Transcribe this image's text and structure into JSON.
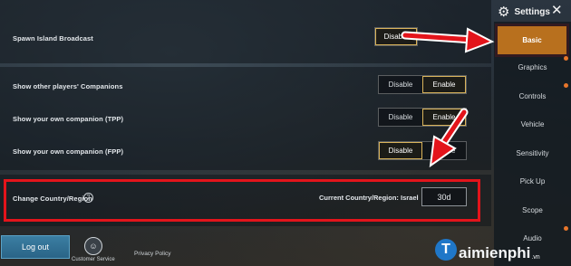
{
  "settings": {
    "spawn_island": {
      "label": "Spawn Island Broadcast",
      "option": "Disable"
    },
    "companions": [
      {
        "label": "Show other players' Companions",
        "disable": "Disable",
        "enable": "Enable",
        "selected": "Enable"
      },
      {
        "label": "Show your own companion (TPP)",
        "disable": "Disable",
        "enable": "Enable",
        "selected": "Enable"
      },
      {
        "label": "Show your own companion (FPP)",
        "disable": "Disable",
        "enable": "Enable",
        "selected": "Disable"
      }
    ],
    "region": {
      "label": "Change Country/Region",
      "help_icon": "?",
      "current": "Current Country/Region: Israel",
      "cooldown": "30d"
    }
  },
  "footer": {
    "logout": "Log out",
    "customer_service": "Customer Service",
    "privacy": "Privacy Policy"
  },
  "sidebar": {
    "title": "Settings",
    "items": [
      {
        "label": "Basic",
        "active": true
      },
      {
        "label": "Graphics",
        "active": false
      },
      {
        "label": "Controls",
        "active": false
      },
      {
        "label": "Vehicle",
        "active": false
      },
      {
        "label": "Sensitivity",
        "active": false
      },
      {
        "label": "Pick Up",
        "active": false
      },
      {
        "label": "Scope",
        "active": false
      },
      {
        "label": "Audio",
        "active": false
      }
    ]
  },
  "watermark": {
    "letter": "T",
    "brand": "aimienphi",
    "suffix": ".vn"
  },
  "colors": {
    "active_tab": "#b8701e",
    "highlight_red": "#e3141b",
    "toggle_selected_border": "#d9b35a",
    "logout_blue": "#2a6487",
    "notification_dot": "#e8762b"
  },
  "icons": [
    "gear-icon",
    "close-icon",
    "help-icon",
    "customer-service-icon",
    "arrow-icon"
  ]
}
